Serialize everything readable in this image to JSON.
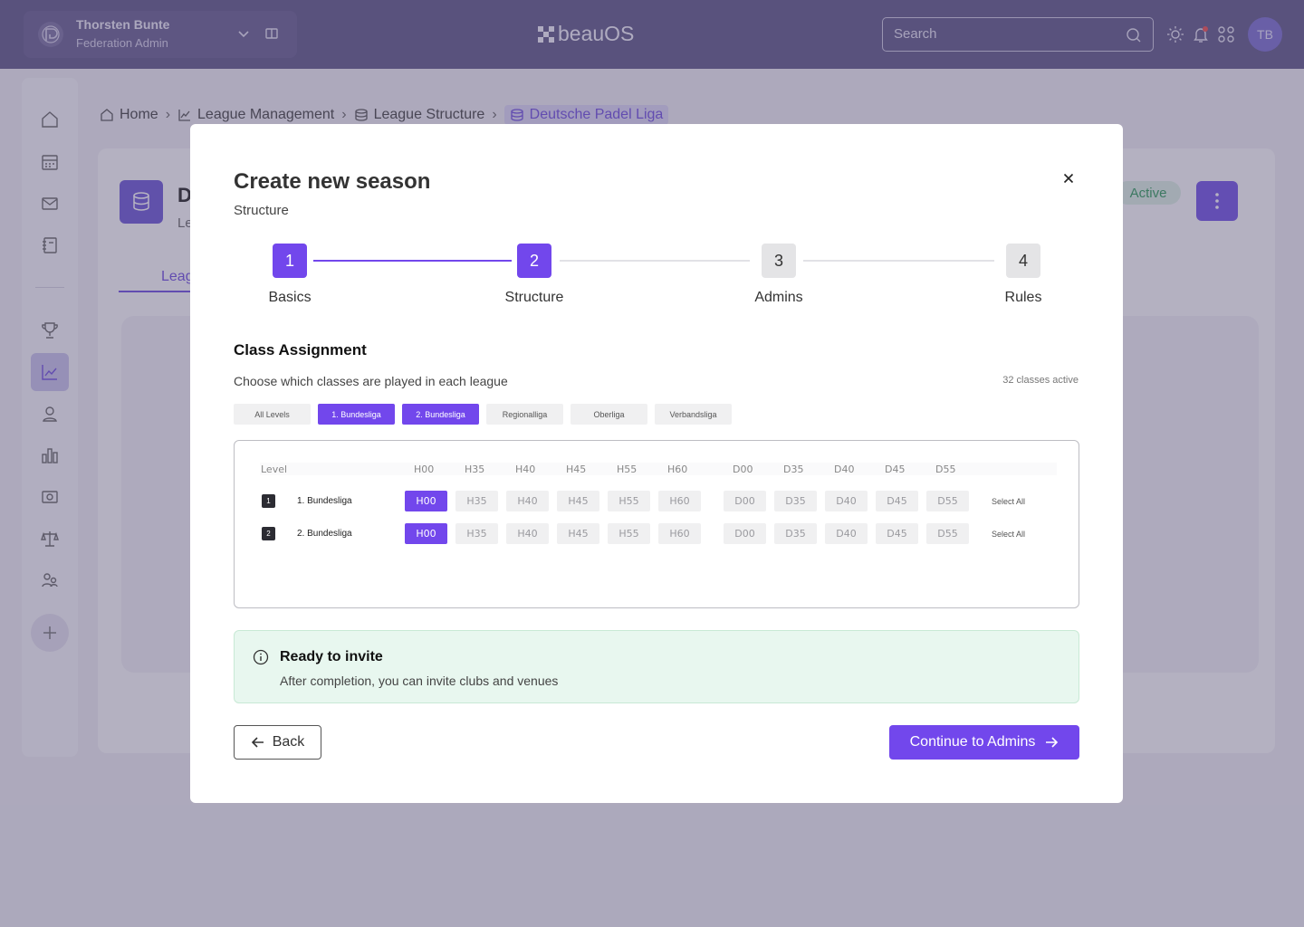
{
  "header": {
    "user_name": "Thorsten Bunte",
    "user_role": "Federation Admin",
    "brand": "beauOS",
    "search_placeholder": "Search",
    "avatar_initials": "TB"
  },
  "sidebar": {
    "items": [
      "home-icon",
      "calendar-icon",
      "mail-icon",
      "notebook-icon",
      "trophy-icon",
      "league-chart-icon",
      "user-location-icon",
      "bar-chart-icon",
      "ticket-icon",
      "scale-icon",
      "users-icon"
    ],
    "active_item": "league-chart-icon"
  },
  "breadcrumb": [
    "Home",
    "League Management",
    "League Structure",
    "Deutsche Padel Liga"
  ],
  "background_page": {
    "title_fragment": "D",
    "subtitle_fragment": "Le",
    "tab_fragment": "Leag",
    "status": "Active"
  },
  "modal": {
    "title": "Create new season",
    "subtitle": "Structure",
    "close_glyph": "×",
    "steps": [
      {
        "number": "1",
        "label": "Basics",
        "state": "complete"
      },
      {
        "number": "2",
        "label": "Structure",
        "state": "current"
      },
      {
        "number": "3",
        "label": "Admins",
        "state": "upcoming"
      },
      {
        "number": "4",
        "label": "Rules",
        "state": "upcoming"
      }
    ],
    "class_assignment": {
      "title": "Class Assignment",
      "description": "Choose which classes are played in each league",
      "count_label": "32 classes active",
      "filters": [
        {
          "label": "All Levels",
          "selected": false
        },
        {
          "label": "1. Bundesliga",
          "selected": true
        },
        {
          "label": "2. Bundesliga",
          "selected": true
        },
        {
          "label": "Regionalliga",
          "selected": false
        },
        {
          "label": "Oberliga",
          "selected": false
        },
        {
          "label": "Verbandsliga",
          "selected": false
        }
      ],
      "level_header": "Level",
      "columns": [
        "H00",
        "H35",
        "H40",
        "H45",
        "H55",
        "H60",
        "D00",
        "D35",
        "D40",
        "D45",
        "D55"
      ],
      "rows": [
        {
          "badge": "1",
          "name": "1. Bundesliga",
          "selected": [
            "H00"
          ],
          "select_all": "Select All"
        },
        {
          "badge": "2",
          "name": "2. Bundesliga",
          "selected": [
            "H00"
          ],
          "select_all": "Select All"
        }
      ]
    },
    "info": {
      "title": "Ready to invite",
      "description": "After completion, you can invite clubs and venues"
    },
    "back_label": "Back",
    "continue_label": "Continue to Admins"
  },
  "colors": {
    "accent": "#7247ec",
    "topbar": "#5f5888",
    "success_bg": "#e8f7ef"
  }
}
